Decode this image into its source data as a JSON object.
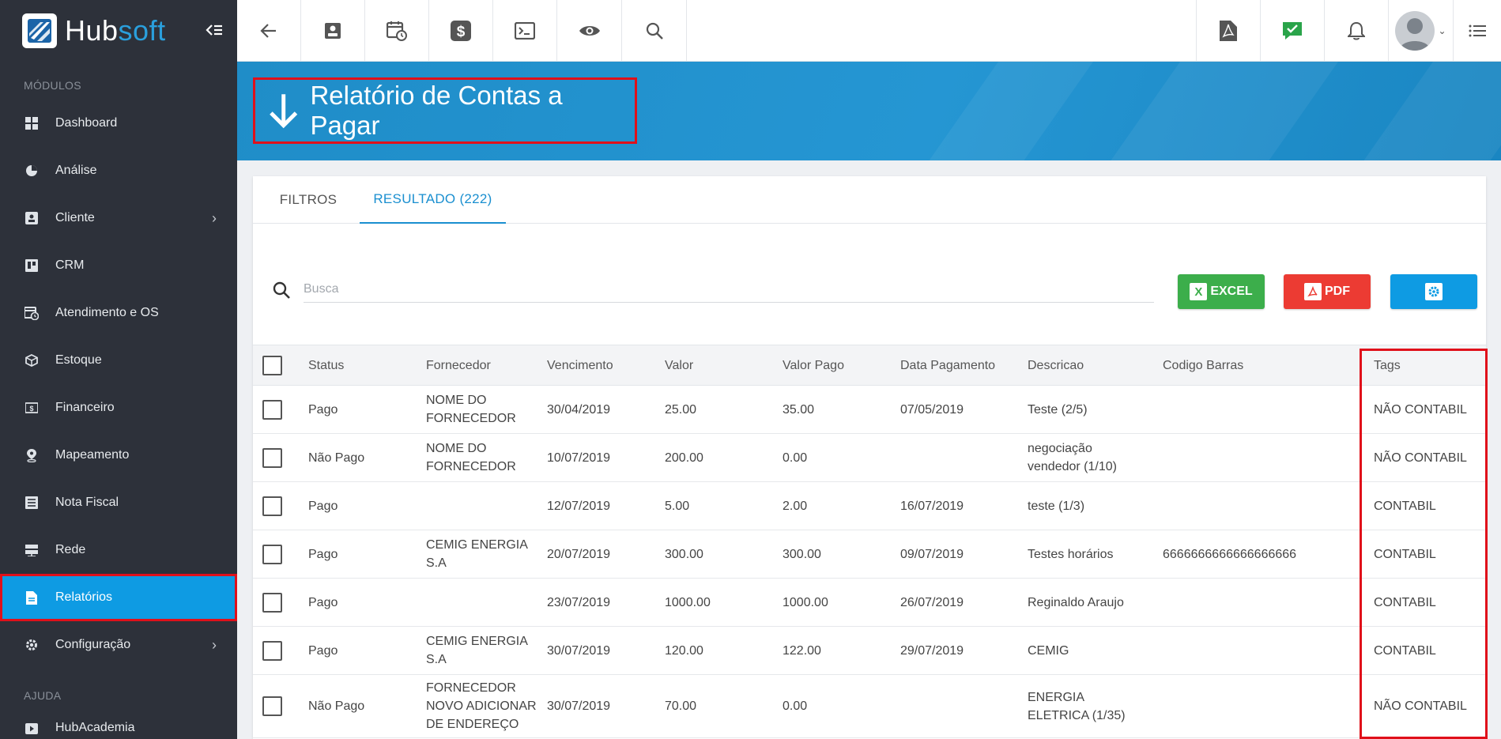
{
  "app": {
    "brand_hub": "Hub",
    "brand_soft": "soft",
    "accent_color": "#0e9be3",
    "highlight_color": "#e0101a"
  },
  "sidebar": {
    "section_modules": "MÓDULOS",
    "items": [
      {
        "label": "Dashboard",
        "icon": "dashboard-icon",
        "has_children": false
      },
      {
        "label": "Análise",
        "icon": "pie-chart-icon",
        "has_children": false
      },
      {
        "label": "Cliente",
        "icon": "contact-card-icon",
        "has_children": true
      },
      {
        "label": "CRM",
        "icon": "kanban-board-icon",
        "has_children": false
      },
      {
        "label": "Atendimento e OS",
        "icon": "calendar-clock-icon",
        "has_children": false
      },
      {
        "label": "Estoque",
        "icon": "box-icon",
        "has_children": false
      },
      {
        "label": "Financeiro",
        "icon": "money-icon",
        "has_children": false
      },
      {
        "label": "Mapeamento",
        "icon": "map-pin-icon",
        "has_children": false
      },
      {
        "label": "Nota Fiscal",
        "icon": "invoice-icon",
        "has_children": false
      },
      {
        "label": "Rede",
        "icon": "server-icon",
        "has_children": false
      },
      {
        "label": "Relatórios",
        "icon": "report-file-icon",
        "has_children": false,
        "active": true
      },
      {
        "label": "Configuração",
        "icon": "gear-icon",
        "has_children": true
      }
    ],
    "section_help": "AJUDA",
    "help_items": [
      {
        "label": "HubAcademia",
        "icon": "play-video-icon"
      }
    ]
  },
  "topbar": {
    "buttons": [
      "back-arrow-icon",
      "contact-card-icon",
      "calendar-clock-icon",
      "dollar-icon",
      "terminal-icon",
      "eye-icon",
      "search-icon",
      "pdf-icon",
      "check-message-icon",
      "bell-icon",
      "avatar",
      "list-menu-icon"
    ]
  },
  "page": {
    "title": "Relatório de Contas a Pagar"
  },
  "tabs": [
    {
      "label": "FILTROS",
      "active": false
    },
    {
      "label": "RESULTADO (222)",
      "active": true
    }
  ],
  "search": {
    "placeholder": "Busca",
    "value": ""
  },
  "actions": {
    "excel_label": "EXCEL",
    "pdf_label": "PDF"
  },
  "table": {
    "columns": [
      "Status",
      "Fornecedor",
      "Vencimento",
      "Valor",
      "Valor Pago",
      "Data Pagamento",
      "Descricao",
      "Codigo Barras",
      "Tags"
    ],
    "rows": [
      {
        "status": "Pago",
        "fornecedor": "NOME DO FORNECEDOR",
        "vencimento": "30/04/2019",
        "valor": "25.00",
        "valor_pago": "35.00",
        "data_pagamento": "07/05/2019",
        "descricao": "Teste (2/5)",
        "codigo_barras": "",
        "tags": "NÃO CONTABIL"
      },
      {
        "status": "Não Pago",
        "fornecedor": "NOME DO FORNECEDOR",
        "vencimento": "10/07/2019",
        "valor": "200.00",
        "valor_pago": "0.00",
        "data_pagamento": "",
        "descricao": "negociação vendedor (1/10)",
        "codigo_barras": "",
        "tags": "NÃO CONTABIL"
      },
      {
        "status": "Pago",
        "fornecedor": "",
        "vencimento": "12/07/2019",
        "valor": "5.00",
        "valor_pago": "2.00",
        "data_pagamento": "16/07/2019",
        "descricao": "teste (1/3)",
        "codigo_barras": "",
        "tags": "CONTABIL"
      },
      {
        "status": "Pago",
        "fornecedor": "CEMIG ENERGIA S.A",
        "vencimento": "20/07/2019",
        "valor": "300.00",
        "valor_pago": "300.00",
        "data_pagamento": "09/07/2019",
        "descricao": "Testes horários",
        "codigo_barras": "6666666666666666666",
        "tags": "CONTABIL"
      },
      {
        "status": "Pago",
        "fornecedor": "",
        "vencimento": "23/07/2019",
        "valor": "1000.00",
        "valor_pago": "1000.00",
        "data_pagamento": "26/07/2019",
        "descricao": "Reginaldo Araujo",
        "codigo_barras": "",
        "tags": "CONTABIL"
      },
      {
        "status": "Pago",
        "fornecedor": "CEMIG ENERGIA S.A",
        "vencimento": "30/07/2019",
        "valor": "120.00",
        "valor_pago": "122.00",
        "data_pagamento": "29/07/2019",
        "descricao": "CEMIG",
        "codigo_barras": "",
        "tags": "CONTABIL"
      },
      {
        "status": "Não Pago",
        "fornecedor": "FORNECEDOR NOVO ADICIONAR DE ENDEREÇO",
        "vencimento": "30/07/2019",
        "valor": "70.00",
        "valor_pago": "0.00",
        "data_pagamento": "",
        "descricao": "ENERGIA ELETRICA (1/35)",
        "codigo_barras": "",
        "tags": "NÃO CONTABIL"
      }
    ]
  }
}
